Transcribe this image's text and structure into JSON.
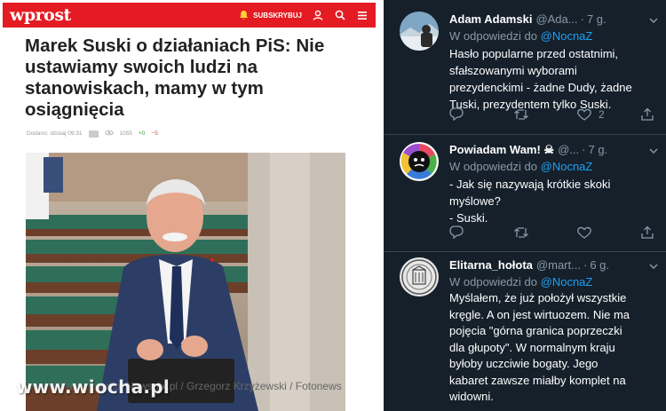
{
  "article": {
    "logo": "wprost",
    "subscribe_label": "SUBSKRYBUJ",
    "headline": "Marek Suski o działaniach PiS: Nie ustawiamy swoich ludzi na stanowiskach, mamy w tym osiągnięcia",
    "meta": {
      "date": "Dodano: dzisiaj 09:31",
      "views": "1055",
      "upvotes": "+0",
      "downvotes": "−5"
    },
    "caption": "Marek Suski, źródło: Newspix.pl / Grzegorz Krzyżewski / Fotonews",
    "watermark": "www.wiocha.pl"
  },
  "tweets": [
    {
      "name": "Adam Adamski",
      "handle": "@Ada...",
      "time": "7 g.",
      "reply_prefix": "W odpowiedzi do",
      "reply_mention": "@NocnaZ",
      "lines": [
        "Hasło popularne przed ostatnimi,",
        "sfałszowanymi wyborami",
        "prezydenckimi - żadne Dudy, żadne",
        "Tuski, prezydentem tylko Suski."
      ],
      "likes": "2"
    },
    {
      "name": "Powiadam Wam! ☠",
      "handle": "@...",
      "time": "7 g.",
      "reply_prefix": "W odpowiedzi do",
      "reply_mention": "@NocnaZ",
      "lines": [
        "- Jak się nazywają krótkie skoki",
        "myślowe?",
        "- Suski."
      ],
      "likes": ""
    },
    {
      "name": "Elitarna_hołota",
      "handle": "@mart...",
      "time": "6 g.",
      "reply_prefix": "W odpowiedzi do",
      "reply_mention": "@NocnaZ",
      "lines": [
        "Myślałem, że już położył wszystkie",
        "kręgle. A on jest wirtuozem. Nie ma",
        "pojęcia \"górna granica poprzeczki",
        "dla głupoty\". W normalnym kraju",
        "byłoby uczciwie bogaty. Jego",
        "kabaret zawsze miałby komplet na",
        "widowni."
      ],
      "likes": ""
    }
  ],
  "colors": {
    "brand_red": "#e41b22",
    "twitter_bg": "#15202b",
    "mention_blue": "#1da1f2",
    "muted": "#8899a6"
  }
}
